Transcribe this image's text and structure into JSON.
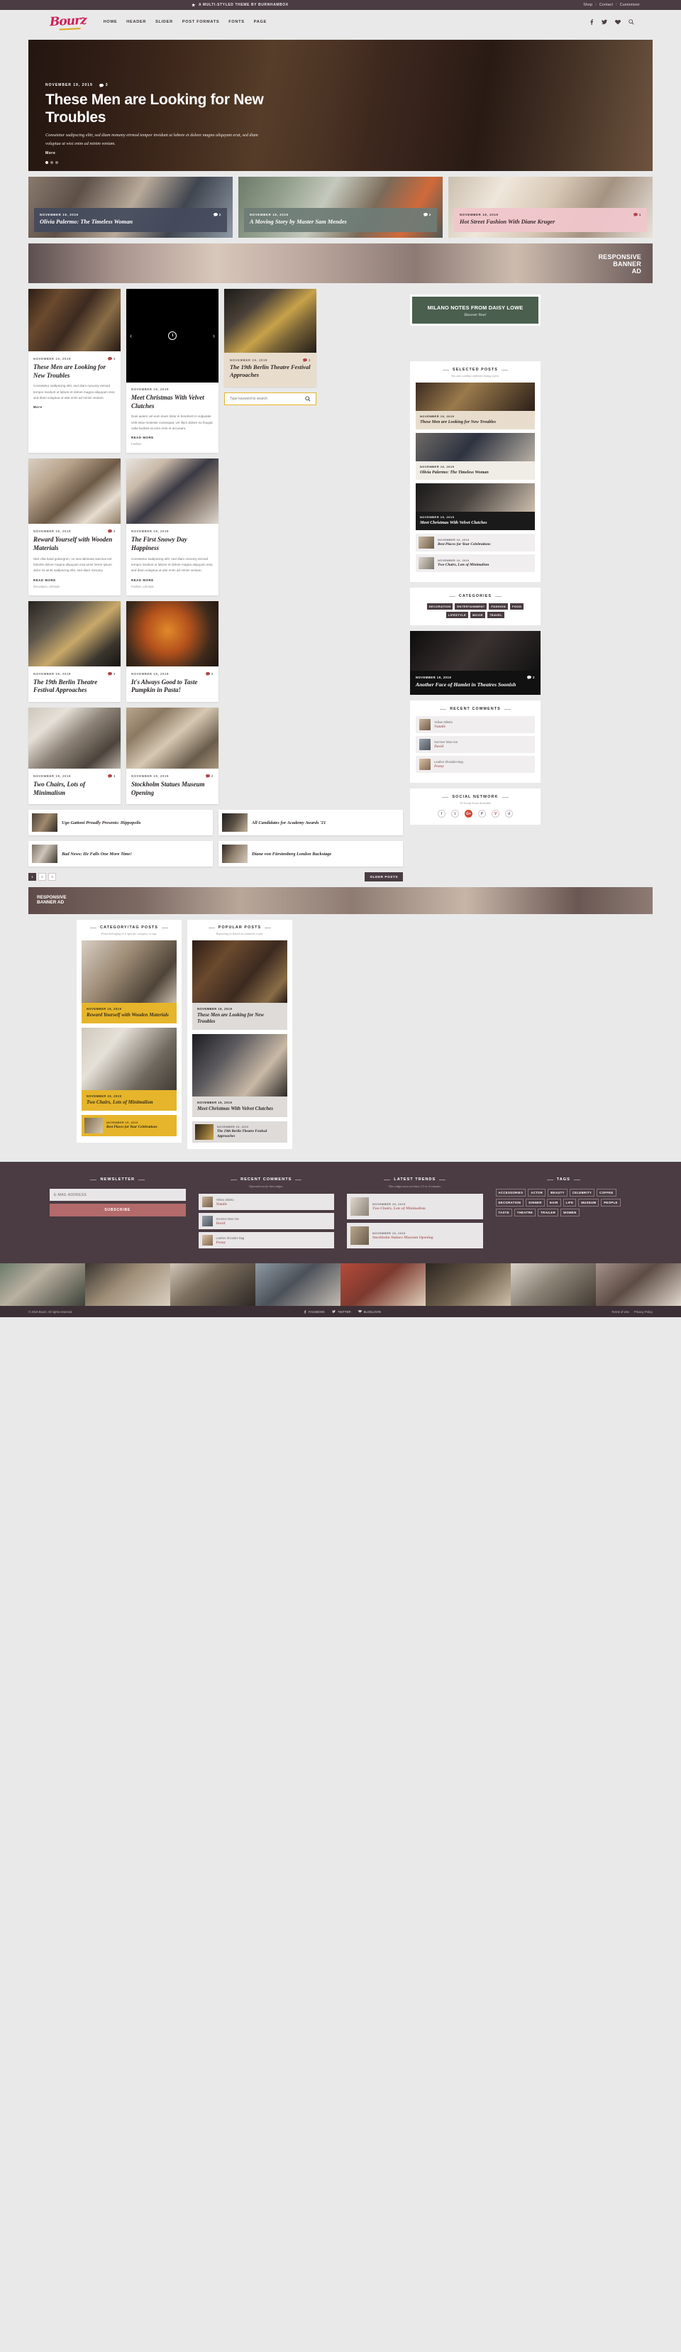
{
  "topbar": {
    "tagline": "A MULTI-STYLED THEME BY BURNHAMBOX",
    "links": [
      "Shop",
      "Contact",
      "Customizer"
    ],
    "sep": "/"
  },
  "header": {
    "logo": "Bourz",
    "nav": [
      "HOME",
      "HEADER",
      "SLIDER",
      "POST FORMATS",
      "FONTS",
      "PAGE"
    ],
    "icons": [
      "facebook-icon",
      "twitter-icon",
      "bloglovin-heart-icon",
      "search-icon"
    ]
  },
  "hero": {
    "date": "NOVEMBER 19, 2019",
    "comments": "3",
    "title": "These Men are Looking for New Troubles",
    "excerpt": "Consetetur sadipscing elitr, sed diam nonumy eirmod tempor invidunt ut labore et dolore magna aliquyam erat, sed diam voluptua ut wisi enim ad minim veniam.",
    "more": "More"
  },
  "features": [
    {
      "date": "NOVEMBER 19, 2019",
      "comments": "2",
      "title": "Olivia Palermo: The Timeless Woman",
      "bg": "dark"
    },
    {
      "date": "NOVEMBER 19, 2019",
      "comments": "2",
      "title": "A Moving Story by Master Sam Mendes",
      "bg": "sage"
    },
    {
      "date": "NOVEMBER 19, 2019",
      "comments": "1",
      "title": "Hot Street Fashion With Diane Kruger",
      "bg": "pink"
    }
  ],
  "banner": {
    "line1": "RESPONSIVE",
    "line2": "BANNER",
    "line3": "AD"
  },
  "posts": [
    {
      "date": "NOVEMBER 19, 2019",
      "comments": "3",
      "title": "These Men are Looking for New Troubles",
      "excerpt": "Consetetur sadipscing elitr, sed diam nonumy eirmod tempor invidunt ut labore et dolore magna aliquyam erat, sed diam voluptua ut wisi enim ad minim veniam.",
      "more": "More",
      "cats": ""
    },
    {
      "date": "NOVEMBER 19, 2019",
      "comments": "",
      "title": "Meet Christmas With Velvet Clutches",
      "excerpt": "Duis autem vel eum iriure dolor in hendrerit in vulputate velit esse molestie consequat, vel illum dolore eu feugiat nulla facilisis at vero eros et accusam.",
      "more": "READ MORE",
      "cats": "Fashion"
    },
    {
      "date": "NOVEMBER 19, 2019",
      "comments": "2",
      "title": "Reward Yourself with Wooden Materials",
      "excerpt": "Stet clita kasd gubergren, no sea takimata sanctus est lobortis dolore magna aliquyam erat amet lorem ipsum dolor sit amet sadipscing elitr, sed diam nonumy.",
      "more": "READ MORE",
      "cats": "Decoration, Lifestyle"
    },
    {
      "date": "NOVEMBER 19, 2019",
      "comments": "",
      "title": "The First Snowy Day Happiness",
      "excerpt": "Consetetur sadipscing elitr, sed diam nonumy eirmod tempor invidunt ut labore et dolore magna aliquyam erat, sed diam voluptua ut wisi enim ad minim veniam.",
      "more": "READ MORE",
      "cats": "Fashion, Lifestyle"
    },
    {
      "date": "NOVEMBER 19, 2019",
      "comments": "3",
      "title": "The 19th Berlin Theatre Festival Approaches",
      "excerpt": "",
      "more": "",
      "cats": ""
    },
    {
      "date": "NOVEMBER 19, 2019",
      "comments": "2",
      "title": "It's Always Good to Taste Pumpkin in Pasta!",
      "excerpt": "",
      "more": "",
      "cats": ""
    },
    {
      "date": "NOVEMBER 19, 2019",
      "comments": "3",
      "title": "Two Chairs, Lots of Minimalism",
      "excerpt": "",
      "more": "",
      "cats": ""
    },
    {
      "date": "NOVEMBER 19, 2019",
      "comments": "2",
      "title": "Stockholm Statues Museum Opening",
      "excerpt": "",
      "more": "",
      "cats": ""
    }
  ],
  "side_featured": {
    "date": "NOVEMBER 19, 2019",
    "comments": "3",
    "title": "The 19th Berlin Theatre Festival Approaches"
  },
  "search": {
    "placeholder": "Type keyword to search",
    "value": ""
  },
  "promo": {
    "title": "MILANO NOTES FROM DAISY LOWE",
    "sub": "Discover Now!"
  },
  "widgets": {
    "selected_posts": {
      "title": "SELECTED POSTS",
      "sub": "You can combine different listing styles.",
      "hero": {
        "date": "NOVEMBER 19, 2019",
        "title": "These Men are Looking for New Troubles"
      },
      "items": [
        {
          "date": "NOVEMBER 19, 2019",
          "title": "Olivia Palermo: The Timeless Woman"
        },
        {
          "date": "NOVEMBER 19, 2019",
          "title": "Meet Christmas With Velvet Clutches"
        },
        {
          "date": "NOVEMBER 19, 2019",
          "title": "Best Places for Your Celebrations"
        },
        {
          "date": "NOVEMBER 19, 2019",
          "title": "Two Chairs, Lots of Minimalism"
        }
      ]
    },
    "categories": {
      "title": "CATEGORIES",
      "tags": [
        "DECORATION",
        "ENTERTAINMENT",
        "FASHION",
        "FOOD",
        "LIFESTYLE",
        "MOVIE",
        "TRAVEL"
      ]
    },
    "dark_feature": {
      "date": "NOVEMBER 19, 2019",
      "comments": "2",
      "title": "Another Face of Hamlet in Theatres Soonish"
    },
    "recent_comments": {
      "title": "RECENT COMMENTS",
      "items": [
        {
          "post": "Yellow Stiletto",
          "author": "Natalie"
        },
        {
          "post": "Summer Man Hat",
          "author": "David"
        },
        {
          "post": "Leather Shoulder Bag",
          "author": "Penny"
        }
      ]
    },
    "social": {
      "title": "SOCIAL NETWORK",
      "sub": "19 Social Icons Available",
      "icons": [
        "f",
        "t",
        "G+",
        "P",
        "V",
        "d"
      ]
    }
  },
  "mini_posts": [
    {
      "title": "Ugo Gattoni Proudly Presents: Hippopolis"
    },
    {
      "title": "All Candidates for Academy Awards '21"
    },
    {
      "title": "Bad News: He Falls One More Time!"
    },
    {
      "title": "Diane von Fürstenberg London Backstage"
    }
  ],
  "pagination": {
    "pages": [
      "1",
      "2",
      "3"
    ],
    "active": "1",
    "older": "OLDER POSTS"
  },
  "banner2": {
    "line1": "RESPONSIVE",
    "line2": "BANNER AD"
  },
  "bottom": {
    "left": {
      "title": "CATEGORY/TAG POSTS",
      "sub": "Posts belonging to a specific category or tag.",
      "items": [
        {
          "date": "NOVEMBER 19, 2019",
          "title": "Reward Yourself with Wooden Materials",
          "tone": "yellow"
        },
        {
          "date": "NOVEMBER 19, 2019",
          "title": "Two Chairs, Lots of Minimalism",
          "tone": "yellow"
        },
        {
          "date": "NOVEMBER 19, 2019",
          "title": "Best Places for Your Celebrations",
          "tone": "yellow-small"
        }
      ]
    },
    "right": {
      "title": "POPULAR POSTS",
      "sub": "Repeating in based on comment count.",
      "items": [
        {
          "date": "NOVEMBER 19, 2019",
          "title": "These Men are Looking for New Troubles",
          "tone": "grey"
        },
        {
          "date": "NOVEMBER 19, 2019",
          "title": "Meet Christmas With Velvet Clutches",
          "tone": "grey"
        },
        {
          "date": "NOVEMBER 19, 2019",
          "title": "The 19th Berlin Theatre Festival Approaches",
          "tone": "grey-small"
        }
      ]
    }
  },
  "footer": {
    "newsletter": {
      "title": "NEWSLETTER",
      "placeholder": "E-MAIL ADDRESS",
      "button": "SUBSCRIBE"
    },
    "recent_comments": {
      "title": "RECENT COMMENTS",
      "sub": "Optional text for this widget.",
      "items": [
        {
          "post": "Yellow Stiletto",
          "author": "Natalie"
        },
        {
          "post": "Summer Man Hat",
          "author": "David"
        },
        {
          "post": "Leather Shoulder Bag",
          "author": "Penny"
        }
      ]
    },
    "latest_trends": {
      "title": "LATEST TRENDS",
      "sub": "This widget area can have 2,3 or 4 columns.",
      "items": [
        {
          "date": "NOVEMBER 19, 2019",
          "title": "Two Chairs, Lots of Minimalism"
        },
        {
          "date": "NOVEMBER 19, 2019",
          "title": "Stockholm Statues Museum Opening"
        }
      ]
    },
    "tags": {
      "title": "TAGS",
      "items": [
        "ACCESSORIES",
        "ACTOR",
        "BEAUTY",
        "CELEBRITY",
        "COFFEE",
        "DECORATION",
        "DINNER",
        "HAIR",
        "LIFE",
        "MUSEUM",
        "PEOPLE",
        "TASTE",
        "THEATRE",
        "TRAILER",
        "WOMEN"
      ]
    }
  },
  "copyright": {
    "left": "© 2019 Bourz. All rights reserved.",
    "social": [
      "FACEBOOK",
      "TWITTER",
      "BLOGLOVIN"
    ],
    "links": [
      "Terms of Use",
      "Privacy Policy"
    ]
  },
  "colors": {
    "accent_pink": "#cf1f5a",
    "dark": "#4a3c42",
    "yellow": "#e6b52b",
    "green": "#4a5f4e",
    "rose": "#b36a6a"
  }
}
